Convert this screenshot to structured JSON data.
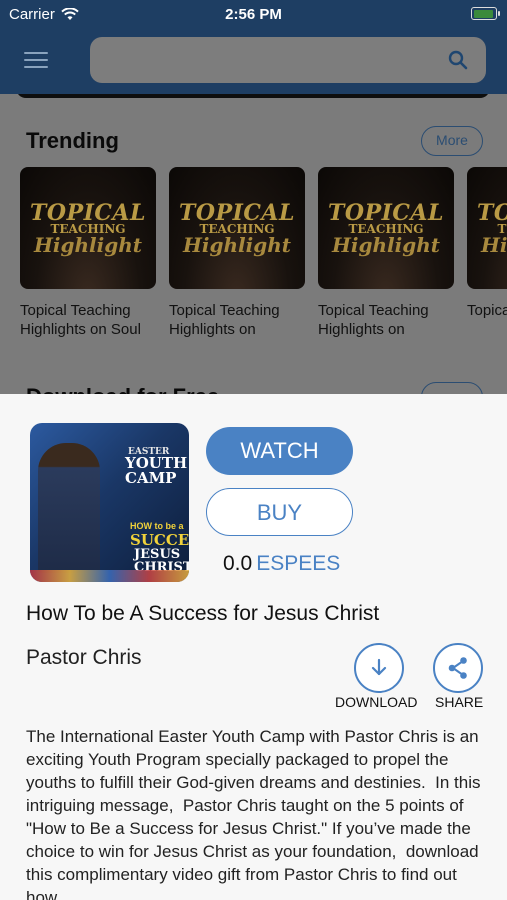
{
  "status_bar": {
    "carrier": "Carrier",
    "time": "2:56 PM"
  },
  "navbar": {
    "search_placeholder": ""
  },
  "trending": {
    "title": "Trending",
    "more_label": "More",
    "thumbnail_text": {
      "line1": "TOPICAL",
      "line2": "TEACHING",
      "line3": "Highlight"
    },
    "items": [
      {
        "title": "Topical Teaching Highlights on Soul"
      },
      {
        "title": "Topical Teaching Highlights on"
      },
      {
        "title": "Topical Teaching Highlights on"
      },
      {
        "title": "Topica Highli"
      }
    ]
  },
  "download_section": {
    "title": "Download for Free"
  },
  "detail": {
    "cover_text": {
      "line1": "EASTER",
      "line2": "YOUTH\nCAMP",
      "line3": "HOW to be a",
      "line4": "SUCCESS",
      "line5": "JESUS\nCHRIST"
    },
    "watch_label": "WATCH",
    "buy_label": "BUY",
    "price_amount": "0.0",
    "price_currency": "ESPEES",
    "title": "How To be A Success for Jesus Christ",
    "author": "Pastor Chris",
    "download_label": "DOWNLOAD",
    "share_label": "SHARE",
    "description": "The International Easter Youth Camp with Pastor Chris is an exciting Youth Program specially packaged to propel the youths to fulfill their God-given dreams and destinies.  In this intriguing message,  Pastor Chris taught on the 5 points of \"How to Be a Success for Jesus Christ.\" If you’ve made the choice to win for Jesus Christ as your foundation,  download this complimentary video gift from Pastor Chris to find out how."
  }
}
